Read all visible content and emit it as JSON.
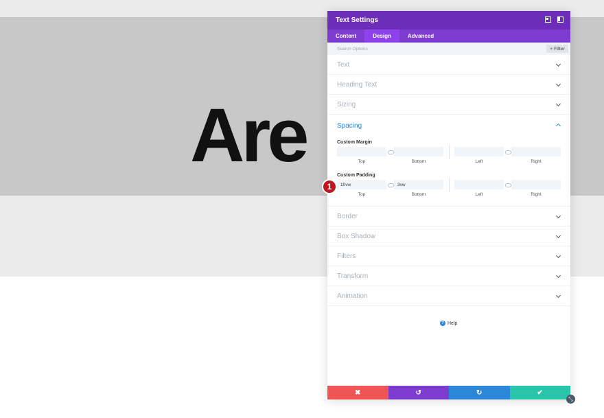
{
  "canvas": {
    "hero_text": "Are"
  },
  "panel": {
    "title": "Text Settings",
    "tabs": [
      {
        "label": "Content"
      },
      {
        "label": "Design"
      },
      {
        "label": "Advanced"
      }
    ],
    "active_tab": "Design",
    "search": {
      "placeholder": "Search Options"
    },
    "filter_label": "Filter",
    "sections_top": [
      {
        "label": "Text"
      },
      {
        "label": "Heading Text"
      },
      {
        "label": "Sizing"
      }
    ],
    "spacing": {
      "title": "Spacing",
      "custom_margin": {
        "label": "Custom Margin",
        "top": "",
        "bottom": "",
        "left": "",
        "right": ""
      },
      "custom_padding": {
        "label": "Custom Padding",
        "top": "10vw",
        "bottom": "3vw",
        "left": "",
        "right": ""
      },
      "captions": {
        "top": "Top",
        "bottom": "Bottom",
        "left": "Left",
        "right": "Right"
      }
    },
    "sections_bottom": [
      {
        "label": "Border"
      },
      {
        "label": "Box Shadow"
      },
      {
        "label": "Filters"
      },
      {
        "label": "Transform"
      },
      {
        "label": "Animation"
      }
    ],
    "help_label": "Help",
    "step_badge": "1"
  },
  "footer": {
    "cancel_icon": "✖",
    "undo_icon": "↺",
    "redo_icon": "↻",
    "save_icon": "✔"
  },
  "colors": {
    "header": "#6c2eb9",
    "tabs": "#7e3bd0",
    "accent_blue": "#2b87da",
    "cancel": "#ef5555",
    "save": "#29c4a9",
    "badge": "#c0151f"
  }
}
